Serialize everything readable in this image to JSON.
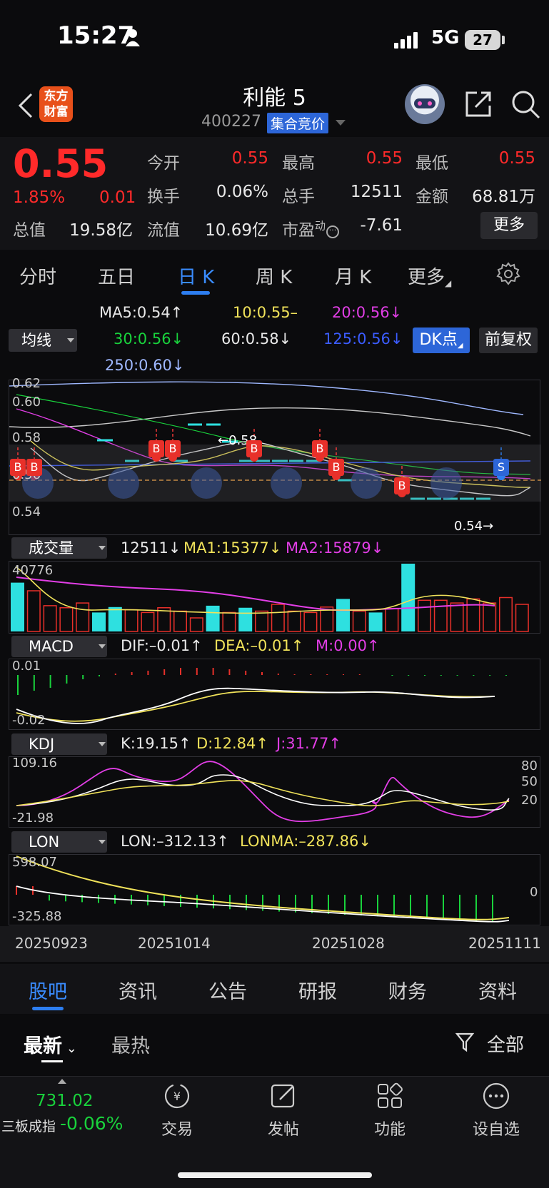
{
  "status_bar": {
    "time": "15:27",
    "network": "5G",
    "battery": "27"
  },
  "header": {
    "stock_name": "利能 5",
    "stock_code": "400227",
    "auction_badge": "集合竞价",
    "logo_line1": "东方",
    "logo_line2": "财富"
  },
  "quote": {
    "price": "0.55",
    "change_pct": "1.85%",
    "change": "0.01",
    "rows": [
      [
        {
          "label": "今开",
          "value": "0.55",
          "color": "red"
        },
        {
          "label": "最高",
          "value": "0.55",
          "color": "red"
        },
        {
          "label": "最低",
          "value": "0.55",
          "color": "red"
        }
      ],
      [
        {
          "label": "换手",
          "value": "0.06%",
          "color": "white"
        },
        {
          "label": "总手",
          "value": "12511",
          "color": "white"
        },
        {
          "label": "金额",
          "value": "68.81万",
          "color": "white"
        }
      ]
    ],
    "total_value_label": "总值",
    "total_value": "19.58亿",
    "float_value_label": "流值",
    "float_value": "10.69亿",
    "pe_label": "市盈",
    "pe_sup": "动",
    "pe_value": "-7.61",
    "more_button": "更多"
  },
  "period_tabs": [
    "分时",
    "五日",
    "日 K",
    "周 K",
    "月 K",
    "更多"
  ],
  "active_period": "日 K",
  "ma_legend": {
    "select_label": "均线",
    "items": [
      {
        "text": "MA5:0.54↑",
        "color": "white"
      },
      {
        "text": "10:0.55–",
        "color": "yellow"
      },
      {
        "text": "20:0.56↓",
        "color": "magenta"
      },
      {
        "text": "30:0.56↓",
        "color": "green"
      },
      {
        "text": "60:0.58↓",
        "color": "white"
      },
      {
        "text": "125:0.56↓",
        "color": "blue"
      },
      {
        "text": "250:0.60↓",
        "color": "lightblue"
      }
    ],
    "dk_button": "DK点",
    "adjust_button": "前复权"
  },
  "kline": {
    "y_labels": [
      "0.62",
      "0.60",
      "0.58",
      "0.56",
      "0.54"
    ],
    "marker_high": "←0.58",
    "marker_low": "0.54→",
    "signal_b": "B",
    "signal_s": "S"
  },
  "volume": {
    "select_label": "成交量",
    "vol": "12511↓",
    "ma1": "MA1:15377↓",
    "ma2": "MA2:15879↓",
    "max_label": "40776"
  },
  "macd": {
    "select_label": "MACD",
    "dif": "DIF:–0.01↑",
    "dea": "DEA:–0.01↑",
    "m": "M:0.00↑",
    "top_label": "0.01",
    "bottom_label": "-0.02"
  },
  "kdj": {
    "select_label": "KDJ",
    "k": "K:19.15↑",
    "d": "D:12.84↑",
    "j": "J:31.77↑",
    "top_label": "109.16",
    "bottom_label": "-21.98",
    "right_labels": [
      "80",
      "50",
      "20"
    ]
  },
  "lon": {
    "select_label": "LON",
    "lon": "LON:–312.13↑",
    "lonma": "LONMA:–287.86↓",
    "top_label": "598.07",
    "bottom_label": "-325.88",
    "right_label": "0"
  },
  "date_axis": [
    "20250923",
    "20251014",
    "20251028",
    "20251111"
  ],
  "content_tabs": [
    "股吧",
    "资讯",
    "公告",
    "研报",
    "财务",
    "资料"
  ],
  "filter_tabs": [
    "最新",
    "最热"
  ],
  "filter_label": "全部",
  "bottom_bar": {
    "index_value": "731.02",
    "index_name": "三板成指",
    "index_pct": "-0.06%",
    "nav": [
      "交易",
      "发帖",
      "功能",
      "设自选"
    ]
  }
}
